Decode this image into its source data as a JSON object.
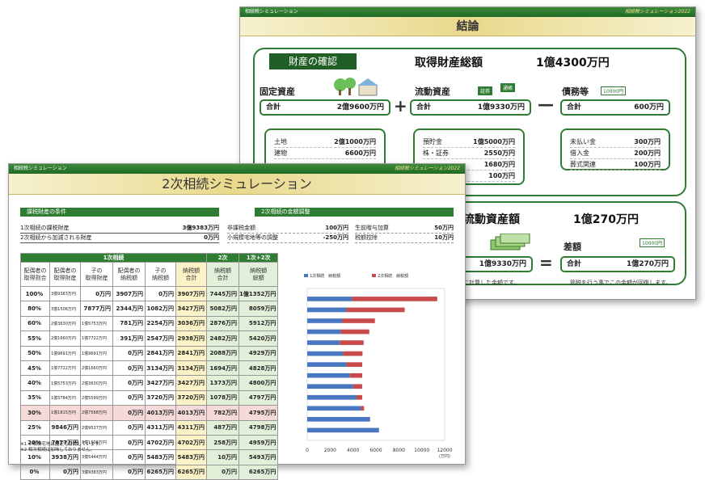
{
  "back": {
    "topbar": {
      "left": "相続税シミュレーション",
      "right": "相続税シミュレーション2022"
    },
    "title": "結論",
    "badge": "財産の確認",
    "total_label": "取得財産総額",
    "total_value": "1億4300万円",
    "fixed": {
      "label": "固定資産",
      "sum_label": "合計",
      "sum": "2億9600万円",
      "items": [
        {
          "k": "土地",
          "v": "2億1000万円"
        },
        {
          "k": "建物",
          "v": "6600万円"
        }
      ]
    },
    "liquid": {
      "label": "流動資産",
      "sum_label": "合計",
      "sum": "1億9330万円",
      "items": [
        {
          "k": "預貯金",
          "v": "1億5000万円"
        },
        {
          "k": "株・証券",
          "v": "2550万円"
        },
        {
          "k": "",
          "v": "1680万円"
        },
        {
          "k": "",
          "v": "100万円"
        }
      ]
    },
    "debt": {
      "label": "債務等",
      "sum_label": "合計",
      "sum": "600万円",
      "items": [
        {
          "k": "未払い金",
          "v": "300万円"
        },
        {
          "k": "借入金",
          "v": "200万円"
        },
        {
          "k": "葬式関連",
          "v": "100万円"
        }
      ]
    },
    "chip_stock": "証券",
    "chip_book": "通帳",
    "chip_bill": "10000円",
    "chip_bill2": "10000円",
    "lower_title": "流動資産額",
    "lower_value": "1億270万円",
    "diff_label": "差額",
    "lower_left_sum": "1億9330万円",
    "lower_right_label": "合計",
    "lower_right_sum": "1億270万円",
    "note_left": "に計算した金額です。",
    "note_right": "節税を行う事でこの金額が回復します。"
  },
  "front": {
    "topbar": {
      "left": "相続税シミュレーション",
      "right": "相続税シミュレーション2022"
    },
    "title": "2次相続シミュレーション",
    "sec1": "課税財産の条件",
    "sec2": "2次相続の金額調整",
    "cond1": [
      {
        "k": "1次相続の課税財産",
        "v": "3億9383万円"
      },
      {
        "k": "2次相続から加減される財産",
        "v": "0万円"
      }
    ],
    "cond2a": [
      {
        "k": "非課税金額",
        "v": "100万円"
      },
      {
        "k": "小規模宅地等の調整",
        "v": "-250万円"
      }
    ],
    "cond2b": [
      {
        "k": "生前贈与加算",
        "v": "50万円"
      },
      {
        "k": "税額控除",
        "v": "10万円"
      }
    ],
    "grp1": "1次相続",
    "grp2": "2次",
    "grp3": "1次+2次",
    "headers": [
      "配偶者の\n取得割合",
      "配偶者の\n取得財産",
      "子の\n取得財産",
      "配偶者の\n納税額",
      "子の\n納税額",
      "納税額\n合計",
      "納税額\n合計",
      "納税額\n総額"
    ],
    "rows": [
      [
        "100%",
        "3億9383万円",
        "0万円",
        "3907万円",
        "0万円",
        "3907万円",
        "7445万円",
        "1億1352万円"
      ],
      [
        "80%",
        "3億1506万円",
        "7877万円",
        "2344万円",
        "1082万円",
        "3427万円",
        "5082万円",
        "8059万円"
      ],
      [
        "60%",
        "2億3630万円",
        "1億5753万円",
        "781万円",
        "2254万円",
        "3036万円",
        "2876万円",
        "5912万円"
      ],
      [
        "55%",
        "2億1660万円",
        "1億7722万円",
        "391万円",
        "2547万円",
        "2938万円",
        "2482万円",
        "5420万円"
      ],
      [
        "50%",
        "1億9691万円",
        "1億9691万円",
        "0万円",
        "2841万円",
        "2841万円",
        "2088万円",
        "4929万円"
      ],
      [
        "45%",
        "1億7722万円",
        "2億1660万円",
        "0万円",
        "3134万円",
        "3134万円",
        "1694万円",
        "4828万円"
      ],
      [
        "40%",
        "1億5753万円",
        "2億3630万円",
        "0万円",
        "3427万円",
        "3427万円",
        "1373万円",
        "4800万円"
      ],
      [
        "35%",
        "1億3784万円",
        "2億5599万円",
        "0万円",
        "3720万円",
        "3720万円",
        "1078万円",
        "4797万円"
      ],
      [
        "30%",
        "1億1815万円",
        "2億7568万円",
        "0万円",
        "4013万円",
        "4013万円",
        "782万円",
        "4795万円"
      ],
      [
        "25%",
        "9846万円",
        "2億9537万円",
        "0万円",
        "4311万円",
        "4311万円",
        "487万円",
        "4798万円"
      ],
      [
        "20%",
        "7877万円",
        "3億1506万円",
        "0万円",
        "4702万円",
        "4702万円",
        "258万円",
        "4959万円"
      ],
      [
        "10%",
        "3938万円",
        "3億5444万円",
        "0万円",
        "5483万円",
        "5483万円",
        "10万円",
        "5493万円"
      ],
      [
        "0%",
        "0万円",
        "3億9383万円",
        "0万円",
        "6265万円",
        "6265万円",
        "0万円",
        "6265万円"
      ]
    ],
    "footnotes": [
      "※1 小規模宅地は固定で計算しています。",
      "※2 相次相続は加味しておりません。"
    ]
  },
  "chart_data": {
    "type": "bar",
    "orientation": "horizontal-stacked",
    "categories": [
      "100%",
      "80%",
      "60%",
      "55%",
      "50%",
      "45%",
      "40%",
      "35%",
      "30%",
      "25%",
      "20%",
      "10%",
      "0%"
    ],
    "series": [
      {
        "name": "1次相続　納税額",
        "color": "#4a78c0",
        "values": [
          3907,
          3427,
          3036,
          2938,
          2841,
          3134,
          3427,
          3720,
          4013,
          4311,
          4702,
          5483,
          6265
        ]
      },
      {
        "name": "2次相続　納税額",
        "color": "#c94a4a",
        "values": [
          7445,
          5082,
          2876,
          2482,
          2088,
          1694,
          1373,
          1078,
          782,
          487,
          258,
          10,
          0
        ]
      }
    ],
    "xlim": [
      0,
      12000
    ],
    "xticks": [
      "0",
      "2000",
      "4000",
      "6000",
      "8000",
      "10000",
      "12000"
    ],
    "xunit": "(万円)"
  }
}
